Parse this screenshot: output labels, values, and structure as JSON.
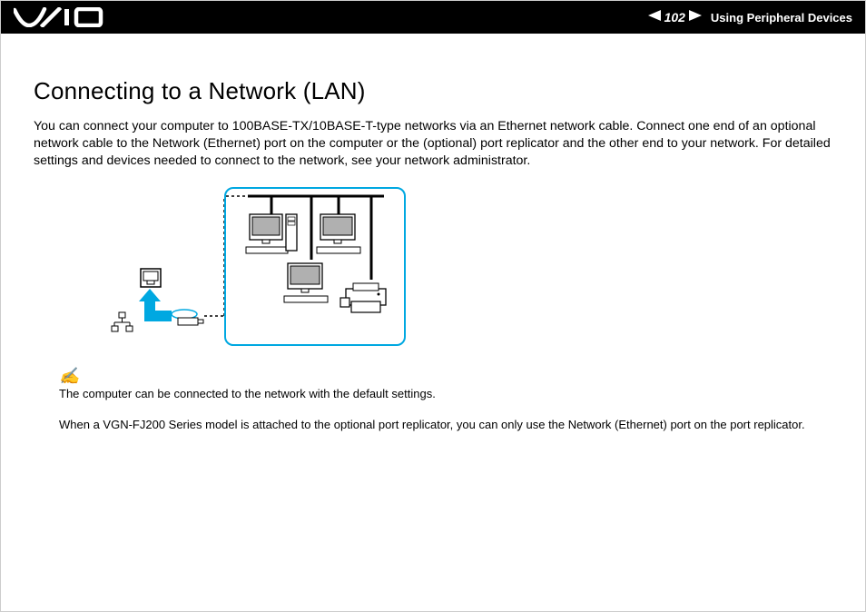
{
  "header": {
    "page_number": "102",
    "section": "Using Peripheral Devices"
  },
  "page": {
    "heading": "Connecting to a Network (LAN)",
    "intro": "You can connect your computer to 100BASE-TX/10BASE-T-type networks via an Ethernet network cable. Connect one end of an optional network cable to the Network (Ethernet) port on the computer or the (optional) port replicator and the other end to your network. For detailed settings and devices needed to connect to the network, see your network administrator.",
    "note1": "The computer can be connected to the network with the default settings.",
    "note2": "When a VGN-FJ200 Series model is attached to the optional port replicator, you can only use the Network (Ethernet) port on the port replicator."
  }
}
